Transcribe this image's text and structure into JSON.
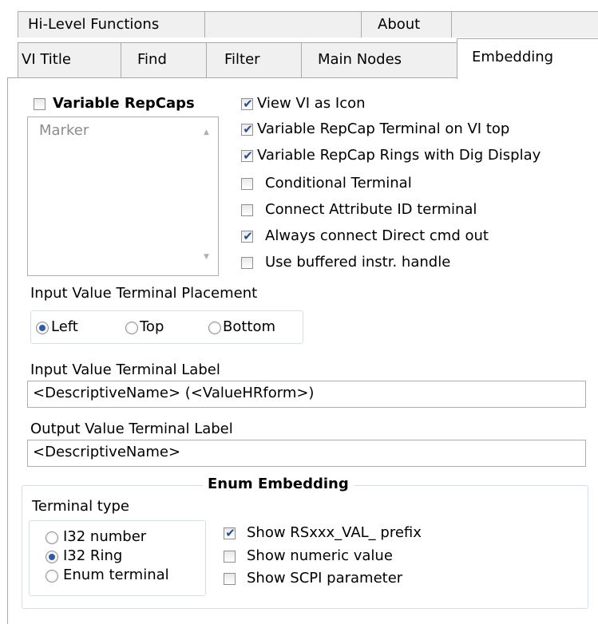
{
  "tabs": {
    "row1": [
      {
        "label": "Hi-Level Functions"
      },
      {
        "label": ""
      },
      {
        "label": "About"
      },
      {
        "label": ""
      }
    ],
    "row2": [
      {
        "label": "VI Title"
      },
      {
        "label": "Find"
      },
      {
        "label": "Filter"
      },
      {
        "label": "Main Nodes"
      },
      {
        "label": "Embedding",
        "selected": true
      }
    ]
  },
  "variable_repcaps": {
    "label": "Variable RepCaps",
    "checked": false,
    "list_items": [
      "Marker"
    ]
  },
  "options": [
    {
      "label": "View VI as Icon",
      "checked": true
    },
    {
      "label": "Variable RepCap Terminal on VI top",
      "checked": true
    },
    {
      "label": "Variable RepCap Rings with Dig Display",
      "checked": true
    },
    {
      "label": "Conditional Terminal",
      "checked": false
    },
    {
      "label": "Connect Attribute ID terminal",
      "checked": false
    },
    {
      "label": "Always connect Direct cmd out",
      "checked": true
    },
    {
      "label": "Use buffered instr. handle",
      "checked": false
    }
  ],
  "placement": {
    "title": "Input Value Terminal Placement",
    "options": [
      {
        "label": "Left",
        "selected": true
      },
      {
        "label": "Top",
        "selected": false
      },
      {
        "label": "Bottom",
        "selected": false
      }
    ]
  },
  "input_label": {
    "title": "Input Value Terminal Label",
    "value": "<DescriptiveName> (<ValueHRform>)"
  },
  "output_label": {
    "title": "Output Value Terminal Label",
    "value": "<DescriptiveName>"
  },
  "enum_embedding": {
    "title": "Enum Embedding",
    "terminal_type": {
      "title": "Terminal type",
      "options": [
        {
          "label": "I32 number",
          "selected": false
        },
        {
          "label": "I32 Ring",
          "selected": true
        },
        {
          "label": "Enum terminal",
          "selected": false
        }
      ]
    },
    "checks": [
      {
        "label": "Show RSxxx_VAL_ prefix",
        "checked": true
      },
      {
        "label": "Show numeric value",
        "checked": false
      },
      {
        "label": "Show SCPI parameter",
        "checked": false
      }
    ]
  },
  "colors": {
    "check_mark": "#2a4d8f",
    "radio_dot": "#2f5aa8",
    "tab_bg": "#f0f0f0",
    "disabled_text": "#8c8c8c"
  },
  "icons": {
    "check": "✔",
    "scroll_up": "▲",
    "scroll_down": "▼"
  }
}
